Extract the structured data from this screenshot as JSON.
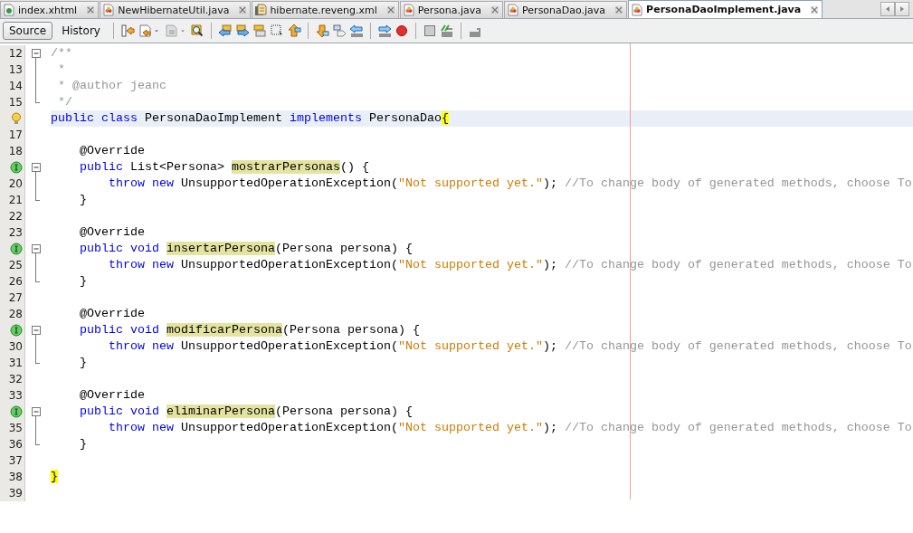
{
  "tabs": [
    {
      "label": "index.xhtml",
      "kind": "web",
      "selected": false
    },
    {
      "label": "NewHibernateUtil.java",
      "kind": "java",
      "selected": false
    },
    {
      "label": "hibernate.reveng.xml",
      "kind": "xml",
      "selected": false
    },
    {
      "label": "Persona.java",
      "kind": "java",
      "selected": false
    },
    {
      "label": "PersonaDao.java",
      "kind": "java",
      "selected": false
    },
    {
      "label": "PersonaDaoImplement.java",
      "kind": "java",
      "selected": true
    }
  ],
  "view_toggle": [
    {
      "label": "Source",
      "selected": true
    },
    {
      "label": "History",
      "selected": false
    }
  ],
  "editor": {
    "lines": [
      {
        "kind": "numbered",
        "number": "12",
        "segments": [
          {
            "text": "/**",
            "kind": "comment"
          }
        ],
        "children": [
          {
            "kind": "numbered",
            "number": "13",
            "segments": [
              {
                "text": " *",
                "kind": "comment"
              }
            ]
          },
          {
            "kind": "numbered",
            "number": "14",
            "segments": [
              {
                "text": " * @author jeanc",
                "kind": "comment"
              }
            ]
          },
          {
            "kind": "numbered",
            "number": "15",
            "segments": [
              {
                "text": " */",
                "kind": "comment"
              }
            ]
          }
        ]
      },
      {
        "kind": "hint",
        "current": true,
        "segments": [
          {
            "text": "public class",
            "kind": "keyword"
          },
          {
            "text": " PersonaDaoImplement ",
            "kind": "plain"
          },
          {
            "text": "implements",
            "kind": "keyword"
          },
          {
            "text": " PersonaDao",
            "kind": "plain"
          },
          {
            "text": "{",
            "kind": "brace"
          }
        ]
      },
      {
        "kind": "numbered",
        "number": "17"
      },
      {
        "kind": "numbered",
        "number": "18",
        "segments": [
          {
            "text": "    @Override",
            "kind": "plain"
          }
        ]
      },
      {
        "kind": "implements",
        "segments": [
          {
            "text": "    public",
            "kind": "keyword"
          },
          {
            "text": " List<Persona> ",
            "kind": "plain"
          },
          {
            "text": "mostrarPersonas",
            "kind": "mark"
          },
          {
            "text": "() {",
            "kind": "plain"
          }
        ],
        "children": [
          {
            "kind": "numbered",
            "number": "20",
            "segments": [
              {
                "text": "        throw new",
                "kind": "keyword"
              },
              {
                "text": " UnsupportedOperationException(",
                "kind": "plain"
              },
              {
                "text": "\"Not supported yet.\"",
                "kind": "string"
              },
              {
                "text": "); ",
                "kind": "plain"
              },
              {
                "text": "//To change body of generated methods, choose To",
                "kind": "comment"
              }
            ]
          },
          {
            "kind": "numbered",
            "number": "21",
            "segments": [
              {
                "text": "    }",
                "kind": "plain"
              }
            ]
          }
        ]
      },
      {
        "kind": "numbered",
        "number": "22"
      },
      {
        "kind": "numbered",
        "number": "23",
        "segments": [
          {
            "text": "    @Override",
            "kind": "plain"
          }
        ]
      },
      {
        "kind": "implements",
        "segments": [
          {
            "text": "    public void ",
            "kind": "keyword"
          },
          {
            "text": "insertarPersona",
            "kind": "mark"
          },
          {
            "text": "(Persona persona) {",
            "kind": "plain"
          }
        ],
        "children": [
          {
            "kind": "numbered",
            "number": "25",
            "segments": [
              {
                "text": "        throw new",
                "kind": "keyword"
              },
              {
                "text": " UnsupportedOperationException(",
                "kind": "plain"
              },
              {
                "text": "\"Not supported yet.\"",
                "kind": "string"
              },
              {
                "text": "); ",
                "kind": "plain"
              },
              {
                "text": "//To change body of generated methods, choose To",
                "kind": "comment"
              }
            ]
          },
          {
            "kind": "numbered",
            "number": "26",
            "segments": [
              {
                "text": "    }",
                "kind": "plain"
              }
            ]
          }
        ]
      },
      {
        "kind": "numbered",
        "number": "27"
      },
      {
        "kind": "numbered",
        "number": "28",
        "segments": [
          {
            "text": "    @Override",
            "kind": "plain"
          }
        ]
      },
      {
        "kind": "implements",
        "segments": [
          {
            "text": "    public void ",
            "kind": "keyword"
          },
          {
            "text": "modificarPersona",
            "kind": "mark"
          },
          {
            "text": "(Persona persona) {",
            "kind": "plain"
          }
        ],
        "children": [
          {
            "kind": "numbered",
            "number": "30",
            "segments": [
              {
                "text": "        throw new",
                "kind": "keyword"
              },
              {
                "text": " UnsupportedOperationException(",
                "kind": "plain"
              },
              {
                "text": "\"Not supported yet.\"",
                "kind": "string"
              },
              {
                "text": "); ",
                "kind": "plain"
              },
              {
                "text": "//To change body of generated methods, choose To",
                "kind": "comment"
              }
            ]
          },
          {
            "kind": "numbered",
            "number": "31",
            "segments": [
              {
                "text": "    }",
                "kind": "plain"
              }
            ]
          }
        ]
      },
      {
        "kind": "numbered",
        "number": "32"
      },
      {
        "kind": "numbered",
        "number": "33",
        "segments": [
          {
            "text": "    @Override",
            "kind": "plain"
          }
        ]
      },
      {
        "kind": "implements",
        "segments": [
          {
            "text": "    public void ",
            "kind": "keyword"
          },
          {
            "text": "eliminarPersona",
            "kind": "mark"
          },
          {
            "text": "(Persona persona) {",
            "kind": "plain"
          }
        ],
        "children": [
          {
            "kind": "numbered",
            "number": "35",
            "segments": [
              {
                "text": "        throw new",
                "kind": "keyword"
              },
              {
                "text": " UnsupportedOperationException(",
                "kind": "plain"
              },
              {
                "text": "\"Not supported yet.\"",
                "kind": "string"
              },
              {
                "text": "); ",
                "kind": "plain"
              },
              {
                "text": "//To change body of generated methods, choose To",
                "kind": "comment"
              }
            ]
          },
          {
            "kind": "numbered",
            "number": "36",
            "segments": [
              {
                "text": "    }",
                "kind": "plain"
              }
            ]
          }
        ]
      },
      {
        "kind": "numbered",
        "number": "37"
      },
      {
        "kind": "numbered",
        "number": "38",
        "segments": [
          {
            "text": "}",
            "kind": "brace"
          }
        ]
      },
      {
        "kind": "numbered",
        "number": "39"
      }
    ]
  }
}
